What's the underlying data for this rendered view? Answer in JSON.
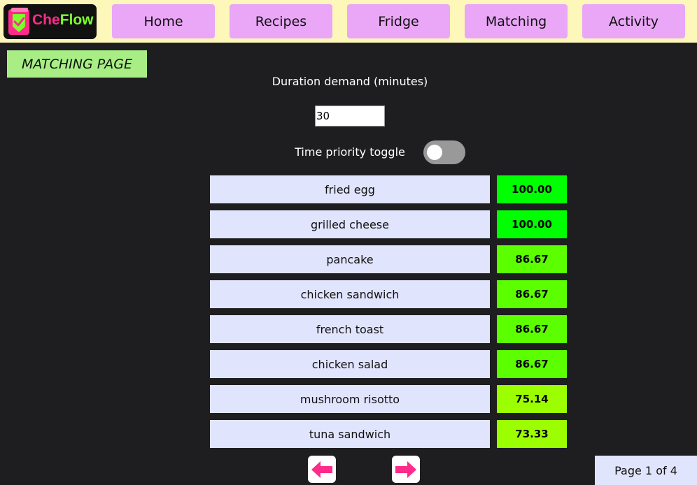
{
  "app": {
    "logo_part1": "Che",
    "logo_part2": "Flow",
    "brand_pink": "#ff2b8a",
    "brand_green": "#7dff2e"
  },
  "nav": {
    "items": [
      "Home",
      "Recipes",
      "Fridge",
      "Matching",
      "Activity"
    ]
  },
  "page": {
    "title": "MATCHING PAGE"
  },
  "filters": {
    "duration_label": "Duration demand (minutes)",
    "duration_value": "30",
    "toggle_label": "Time priority toggle",
    "toggle_on": false
  },
  "results": [
    {
      "name": "fried egg",
      "score": "100.00",
      "color": "#00ff00"
    },
    {
      "name": "grilled cheese",
      "score": "100.00",
      "color": "#00ff00"
    },
    {
      "name": "pancake",
      "score": "86.67",
      "color": "#5cff00"
    },
    {
      "name": "chicken sandwich",
      "score": "86.67",
      "color": "#5cff00"
    },
    {
      "name": "french toast",
      "score": "86.67",
      "color": "#5cff00"
    },
    {
      "name": "chicken salad",
      "score": "86.67",
      "color": "#5cff00"
    },
    {
      "name": "mushroom risotto",
      "score": "75.14",
      "color": "#9cff00"
    },
    {
      "name": "tuna sandwich",
      "score": "73.33",
      "color": "#9cff00"
    }
  ],
  "pagination": {
    "prev_icon": "arrow-left-icon",
    "next_icon": "arrow-right-icon",
    "arrow_color": "#ff2b8a",
    "label": "Page 1 of 4"
  }
}
